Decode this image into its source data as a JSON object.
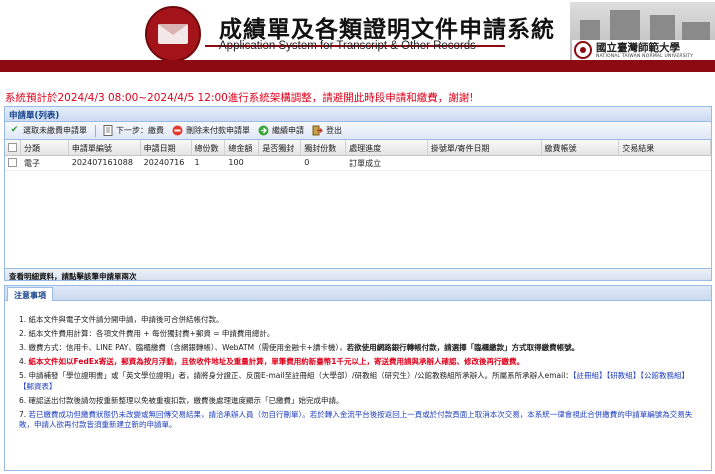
{
  "header": {
    "title_zh": "成績單及各類證明文件申請系統",
    "title_en": "Application System for Transcript & Other Records",
    "university_zh": "國立臺灣師範大學",
    "university_en": "NATIONAL TAIWAN NORMAL UNIVERSITY"
  },
  "notice": "系統預計於2024/4/3 08:00~2024/4/5 12:00進行系統架構調整，請避開此時段申請和繳費，謝謝!",
  "panel": {
    "title": "申請單(列表)",
    "toolbar": {
      "select": "選取未繳費申請單",
      "next": "下一步：繳費",
      "delete": "刪除未付款申請單",
      "continue": "繼續申請",
      "logout": "登出"
    },
    "columns": [
      "分類",
      "申請單編號",
      "申請日期",
      "總份數",
      "總金額",
      "是否獨封",
      "獨封份數",
      "處理進度",
      "掛號單/寄件日期",
      "繳費帳號",
      "交易結果"
    ],
    "rows": [
      {
        "category": "電子",
        "id": "202407161088",
        "date": "20240716",
        "copies": "1",
        "amount": "100",
        "sealed": "",
        "sealed_copies": "0",
        "progress": "訂單成立",
        "tracking": "",
        "account": "",
        "result": ""
      }
    ],
    "footer": "查看明細資料，請點擊該筆申請單兩次"
  },
  "notes": {
    "tab": "注意事項",
    "items": [
      {
        "num": "1.",
        "text": "紙本文件與電子文件請分開申請，申請後可合併結帳付款。"
      },
      {
        "num": "2.",
        "text": "紙本文件費用計算：各項文件費用 + 每份獨封費+郵資 = 申請費用總計。"
      },
      {
        "num": "3.",
        "text": "繳費方式：信用卡、LINE PAY、臨櫃繳費（含網銀轉帳）、WebATM（需使用金融卡+讀卡機），",
        "bold": "若欲使用網路銀行轉帳付款，請選擇「臨櫃繳款」方式取得繳費帳號。"
      },
      {
        "num": "4.",
        "red": "紙本文件如以FedEx寄送，郵資為按月浮動，且依收件地址及重量計算，單筆費用約新臺幣1千元以上，寄送費用請與承辦人確認、修改後再行繳費。"
      },
      {
        "num": "5.",
        "text": "申請補發「學位證明書」或「英文學位證明」者，請將身分證正、反面E-mail至註冊組（大學部）/研教組（研究生）/公館教務組所承辦人。所屬系所承辦人email：",
        "link1": "【註冊組】",
        "link2": "【研教組】",
        "link3": "【公館教務組】",
        "link4": "【郵資表】"
      },
      {
        "num": "6.",
        "text": "確認送出付款後請勿按重新整理以免被重複扣款，繳費後處理進度顯示「已繳費」始完成申請。"
      },
      {
        "num": "7.",
        "blue": "若已繳費成功但繳費狀態仍未改變或無回傳交易結果，請洽承辦人員（勿自行刪單）。若於轉入金流平台後按返回上一頁或於付款頁面上取消本次交易，本系統一律會視此合併繳費的申請單編號為交易失敗，申請人欲再付款皆須重新建立新的申請單。"
      }
    ]
  }
}
